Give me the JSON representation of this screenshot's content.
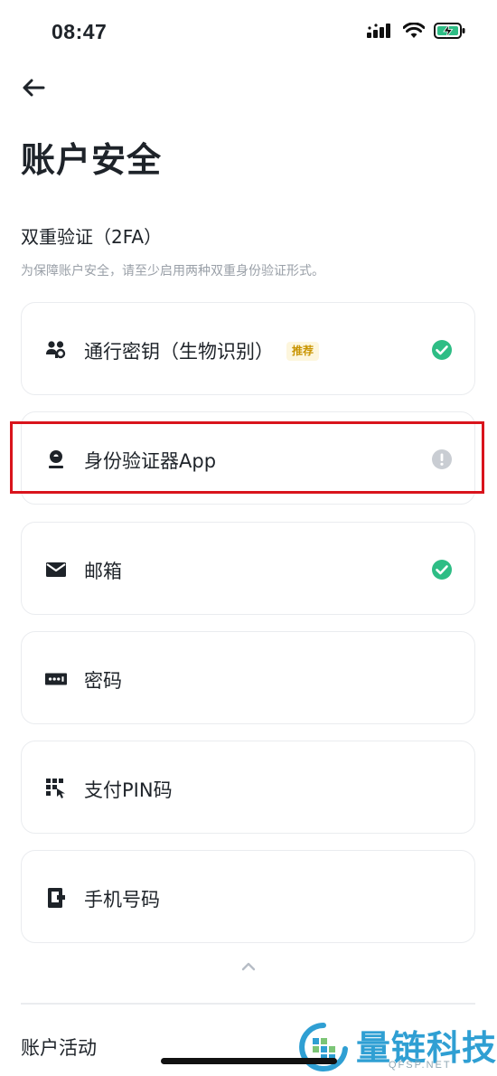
{
  "status_bar": {
    "time": "08:47",
    "icons": [
      "signal-icon",
      "wifi-icon",
      "battery-charging-icon"
    ],
    "battery_color": "#2ebd85"
  },
  "nav": {
    "back_icon": "arrow-left-icon"
  },
  "page": {
    "title": "账户安全"
  },
  "section_2fa": {
    "title": "双重验证（2FA）",
    "description": "为保障账户安全，请至少启用两种双重身份验证形式。",
    "items": [
      {
        "label": "通行密钥（生物识别）",
        "badge": "推荐",
        "icon": "passkey-icon",
        "status": "enabled",
        "status_icon": "check-circle-icon"
      },
      {
        "label": "身份验证器App",
        "badge": "",
        "icon": "authenticator-icon",
        "status": "warning",
        "status_icon": "exclamation-circle-icon"
      },
      {
        "label": "邮箱",
        "badge": "",
        "icon": "mail-icon",
        "status": "enabled",
        "status_icon": "check-circle-icon"
      },
      {
        "label": "密码",
        "badge": "",
        "icon": "password-icon",
        "status": "none",
        "status_icon": ""
      },
      {
        "label": "支付PIN码",
        "badge": "",
        "icon": "pin-keypad-icon",
        "status": "none",
        "status_icon": ""
      },
      {
        "label": "手机号码",
        "badge": "",
        "icon": "phone-icon",
        "status": "none",
        "status_icon": ""
      }
    ]
  },
  "section_activity": {
    "title": "账户活动"
  },
  "watermark": {
    "text": "量链科技",
    "subtext": "QFSP.NET"
  },
  "colors": {
    "success": "#2ebd85",
    "muted": "#c9cdd3",
    "highlight": "#d9141c",
    "badge_text": "#c99400",
    "badge_bg": "#fdf6dd",
    "watermark": "#2f9fd3"
  }
}
